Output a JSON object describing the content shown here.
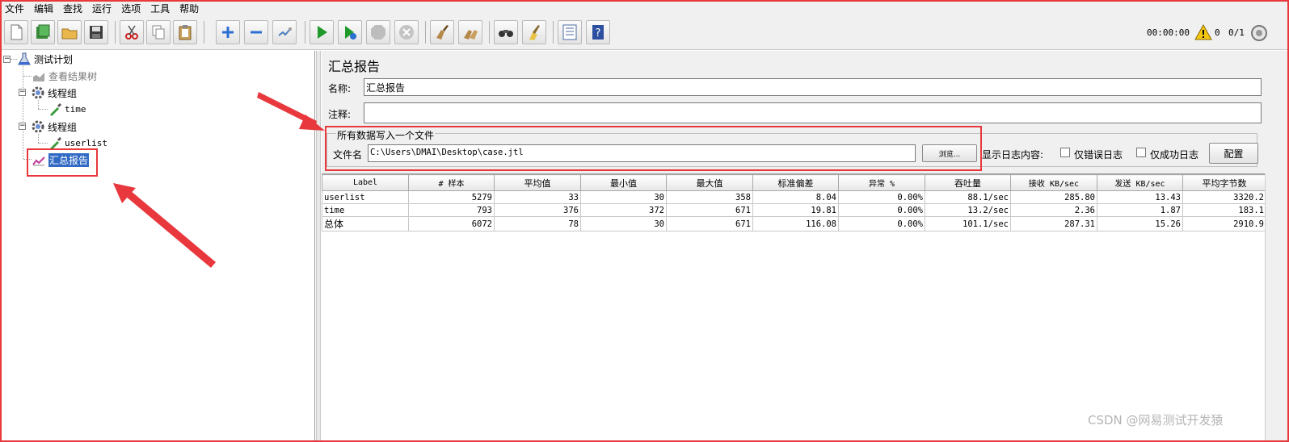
{
  "menu": [
    "文件",
    "编辑",
    "查找",
    "运行",
    "选项",
    "工具",
    "帮助"
  ],
  "toolbar": {
    "buttons": [
      "new-icon",
      "templates-icon",
      "open-icon",
      "save-icon",
      "cut-icon",
      "copy-icon",
      "paste-icon",
      "expand-icon",
      "collapse-icon",
      "toggle-icon",
      "start-icon",
      "start-no-pause-icon",
      "stop-icon",
      "shutdown-icon",
      "clear-icon",
      "clear-all-icon",
      "search-icon",
      "reset-search-icon",
      "function-helper-icon",
      "help-icon"
    ],
    "timer": "00:00:00",
    "error_count": "0",
    "threads": "0/1"
  },
  "tree": {
    "root": "测试计划",
    "items": [
      {
        "label": "查看结果树",
        "kind": "listener"
      },
      {
        "label": "线程组",
        "kind": "thread-group"
      },
      {
        "label": "time",
        "kind": "sampler"
      },
      {
        "label": "线程组",
        "kind": "thread-group"
      },
      {
        "label": "userlist",
        "kind": "sampler"
      },
      {
        "label": "汇总报告",
        "kind": "listener",
        "selected": true
      }
    ]
  },
  "panel": {
    "title": "汇总报告",
    "name_label": "名称:",
    "name_value": "汇总报告",
    "comment_label": "注释:",
    "comment_value": "",
    "file_group_label": "所有数据写入一个文件",
    "file_label": "文件名",
    "file_value": "C:\\Users\\DMAI\\Desktop\\case.jtl",
    "browse_label": "浏览...",
    "log_label": "显示日志内容:",
    "errors_only_label": "仅错误日志",
    "success_only_label": "仅成功日志",
    "configure_label": "配置"
  },
  "table": {
    "columns": [
      "Label",
      "# 样本",
      "平均值",
      "最小值",
      "最大值",
      "标准偏差",
      "异常 %",
      "吞吐量",
      "接收 KB/sec",
      "发送 KB/sec",
      "平均字节数"
    ],
    "rows": [
      [
        "userlist",
        "5279",
        "33",
        "30",
        "358",
        "8.04",
        "0.00%",
        "88.1/sec",
        "285.80",
        "13.43",
        "3320.2"
      ],
      [
        "time",
        "793",
        "376",
        "372",
        "671",
        "19.81",
        "0.00%",
        "13.2/sec",
        "2.36",
        "1.87",
        "183.1"
      ],
      [
        "总体",
        "6072",
        "78",
        "30",
        "671",
        "116.08",
        "0.00%",
        "101.1/sec",
        "287.31",
        "15.26",
        "2910.9"
      ]
    ]
  },
  "watermark": "CSDN @网易测试开发猿",
  "colors": {
    "annotation_red": "#e8383d",
    "selection_blue": "#316ac5"
  }
}
